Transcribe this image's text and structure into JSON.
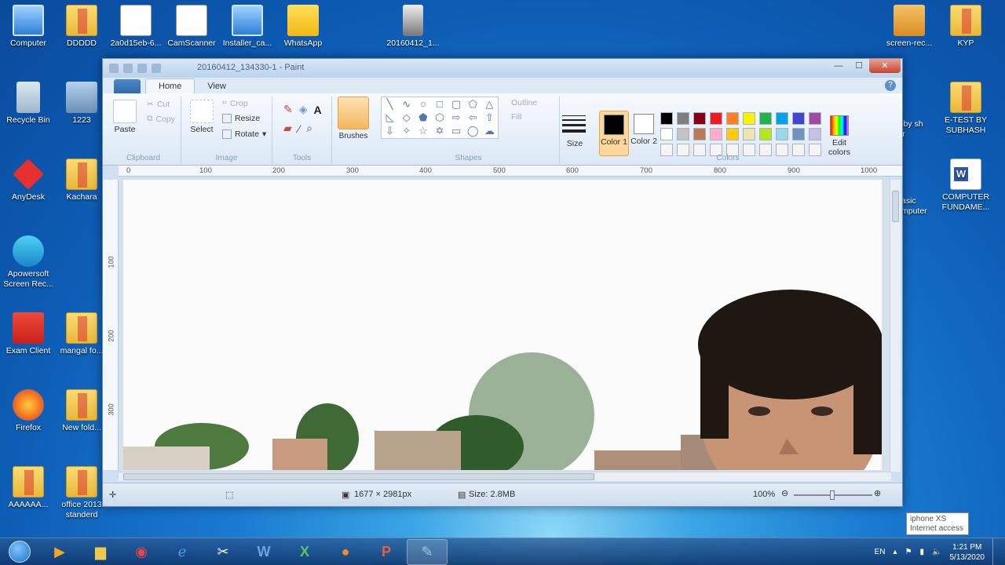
{
  "desktop": {
    "icons_left": [
      {
        "label": "Computer"
      },
      {
        "label": "Recycle Bin"
      },
      {
        "label": "AnyDesk"
      },
      {
        "label": "Apowersoft Screen Rec..."
      },
      {
        "label": "Exam Client"
      },
      {
        "label": "Firefox"
      },
      {
        "label": "AAAAAA..."
      }
    ],
    "icons_col2": [
      {
        "label": "DDDDD"
      },
      {
        "label": "1223"
      },
      {
        "label": "Kachara"
      },
      {
        "label": "mangal fo..."
      },
      {
        "label": "New fold..."
      },
      {
        "label": "office 2013 standerd"
      }
    ],
    "icons_top": [
      {
        "label": "2a0d15eb-6..."
      },
      {
        "label": "CamScanner"
      },
      {
        "label": "Installer_ca..."
      },
      {
        "label": "WhatsApp"
      },
      {
        "label": "20160412_1..."
      }
    ],
    "icons_right": [
      {
        "label": "screen-rec..."
      },
      {
        "label": "KYP"
      },
      {
        "label": "E-TEST BY SUBHASH"
      },
      {
        "label": "COMPUTER FUNDAME..."
      },
      {
        "label": "iz by sh Sir"
      },
      {
        "label": "asic mputer"
      }
    ]
  },
  "paint": {
    "title": "20160412_134330-1 - Paint",
    "tabs": [
      "Home",
      "View"
    ],
    "clipboard": {
      "paste": "Paste",
      "cut": "Cut",
      "copy": "Copy",
      "label": "Clipboard"
    },
    "image": {
      "select": "Select",
      "crop": "Crop",
      "resize": "Resize",
      "rotate": "Rotate",
      "label": "Image"
    },
    "tools": {
      "label": "Tools"
    },
    "brushes": "Brushes",
    "shapes": {
      "label": "Shapes",
      "outline": "Outline",
      "fill": "Fill"
    },
    "size": "Size",
    "color1": "Color 1",
    "color2": "Color 2",
    "colors_label": "Colors",
    "edit_colors": "Edit colors",
    "ruler_h": [
      "0",
      "100",
      "200",
      "300",
      "400",
      "500",
      "600",
      "700",
      "800",
      "900",
      "1000"
    ],
    "ruler_v": [
      "100",
      "200",
      "300"
    ],
    "status": {
      "dimensions": "1677 × 2981px",
      "size": "Size: 2.8MB",
      "zoom": "100%"
    }
  },
  "palette_colors": [
    "#000000",
    "#7f7f7f",
    "#880015",
    "#ed1c24",
    "#ff7f27",
    "#fff200",
    "#22b14c",
    "#00a2e8",
    "#3f48cc",
    "#a349a4",
    "#ffffff",
    "#c3c3c3",
    "#b97a57",
    "#ffaec9",
    "#ffc90e",
    "#efe4b0",
    "#b5e61d",
    "#99d9ea",
    "#7092be",
    "#c8bfe7",
    "#f5f5f5",
    "#f5f5f5",
    "#f5f5f5",
    "#f5f5f5",
    "#f5f5f5",
    "#f5f5f5",
    "#f5f5f5",
    "#f5f5f5",
    "#f5f5f5",
    "#f5f5f5"
  ],
  "taskbar": {
    "lang": "EN",
    "time": "1:21 PM",
    "date": "5/13/2020"
  },
  "tooltip": {
    "line1": "iphone XS",
    "line2": "Internet access"
  }
}
